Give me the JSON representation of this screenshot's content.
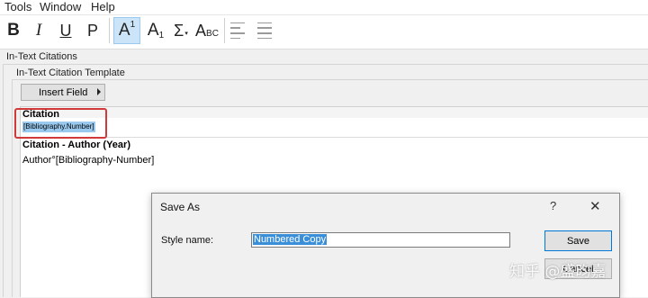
{
  "menu": {
    "items": [
      "Tools",
      "Window",
      "Help"
    ]
  },
  "toolbar": {
    "bold": "B",
    "italic": "I",
    "underline": "U",
    "plain": "P",
    "superscript_base": "A",
    "superscript_mark": "1",
    "subscript_base": "A",
    "subscript_mark": "1",
    "symbol": "Σ",
    "smallcaps_big": "A",
    "smallcaps_small": "BC",
    "icons": [
      "bold-icon",
      "italic-icon",
      "underline-icon",
      "plain-icon",
      "superscript-icon",
      "subscript-icon",
      "symbol-icon",
      "small-caps-icon",
      "align-left-icon",
      "justify-icon"
    ]
  },
  "section": {
    "title": "In-Text Citations",
    "template_title": "In-Text Citation Template",
    "insert_field_label": "Insert Field"
  },
  "editor": {
    "citation_heading": "Citation",
    "citation_field": "Bibliography.Number",
    "author_year_heading": "Citation - Author (Year)",
    "author_year_template": "Author°[Bibliography-Number]"
  },
  "dialog": {
    "title": "Save As",
    "help": "?",
    "close": "✕",
    "style_name_label": "Style name:",
    "style_name_value": "Numbered Copy",
    "save_label": "Save",
    "cancel_label": "Cancel"
  },
  "watermark": "知乎 @盛昀嘉",
  "colors": {
    "highlight": "#99c9ef",
    "annotation_box": "#d03a3a",
    "focus_border": "#0078d7"
  }
}
